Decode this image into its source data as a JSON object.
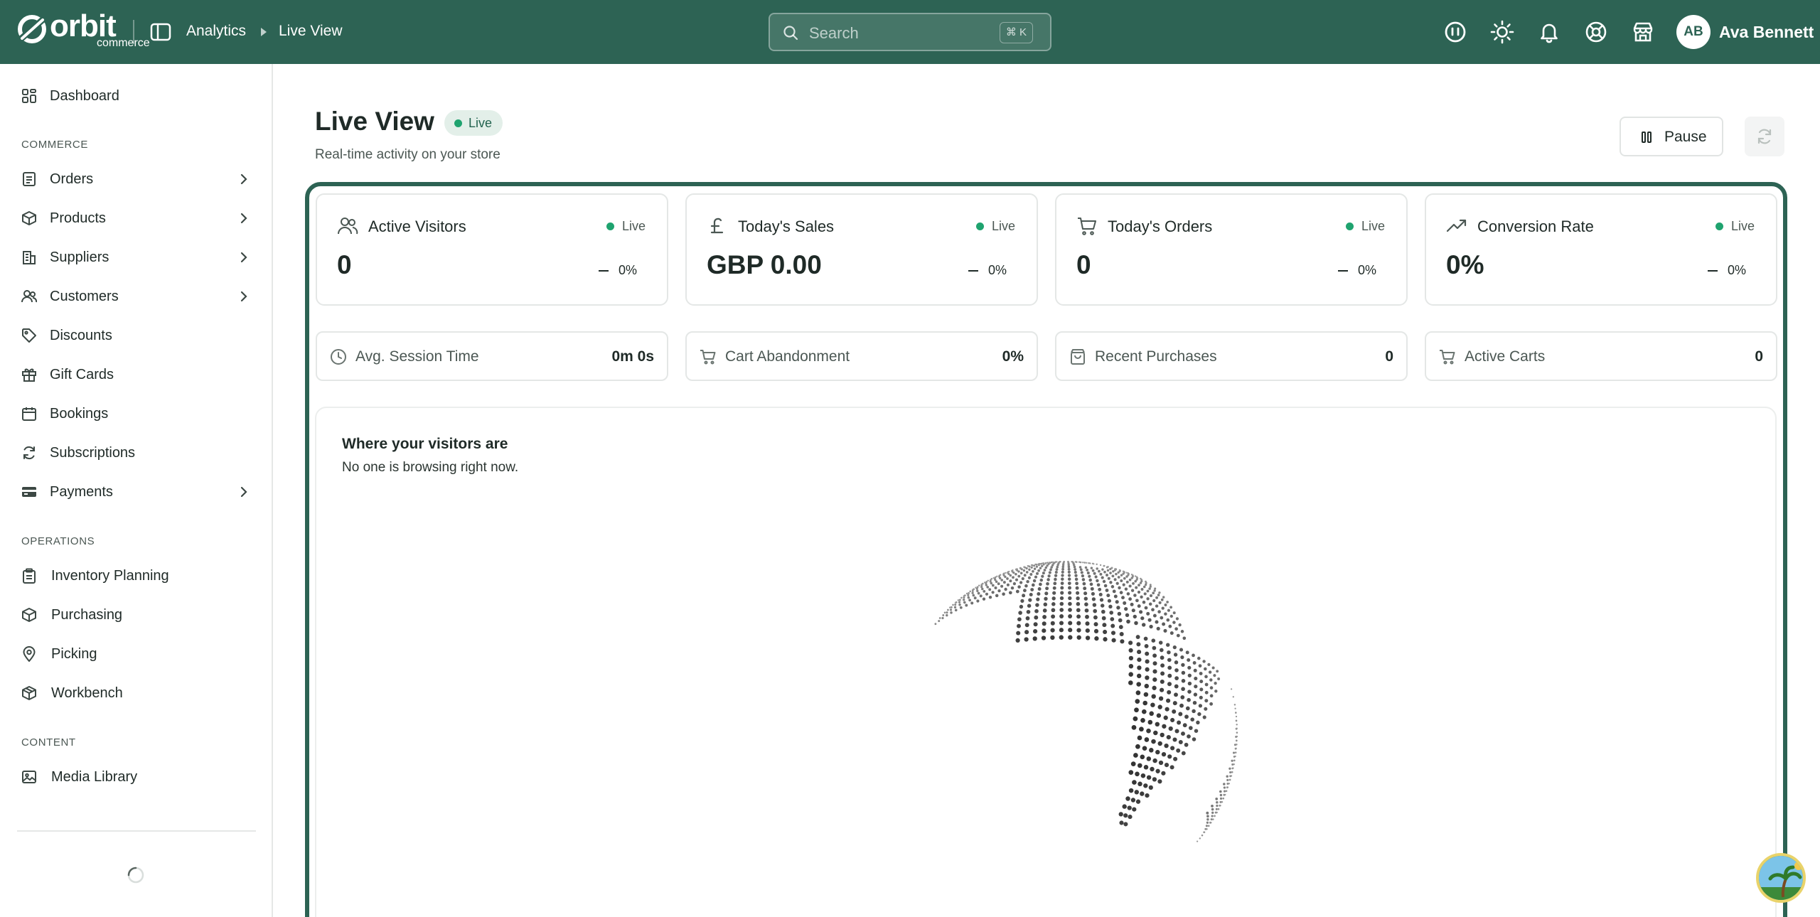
{
  "brand": {
    "name": "orbit",
    "sub": "commerce"
  },
  "topbar": {
    "breadcrumb": [
      "Analytics",
      "Live View"
    ],
    "search": {
      "placeholder": "Search",
      "shortcut": "⌘ K"
    },
    "icons": [
      "ai-assistant-icon",
      "theme-toggle-icon",
      "notifications-icon",
      "help-icon",
      "storefront-icon"
    ],
    "user": {
      "initials": "AB",
      "name": "Ava Bennett"
    }
  },
  "sidebar": {
    "top": [
      {
        "label": "Dashboard",
        "icon": "dashboard-icon"
      }
    ],
    "sections": [
      {
        "title": "COMMERCE",
        "items": [
          {
            "label": "Orders",
            "icon": "orders-icon",
            "chevron": true
          },
          {
            "label": "Products",
            "icon": "box-icon",
            "chevron": true
          },
          {
            "label": "Suppliers",
            "icon": "building-icon",
            "chevron": true
          },
          {
            "label": "Customers",
            "icon": "users-icon",
            "chevron": true
          },
          {
            "label": "Discounts",
            "icon": "tag-icon",
            "chevron": false
          },
          {
            "label": "Gift Cards",
            "icon": "gift-icon",
            "chevron": false
          },
          {
            "label": "Bookings",
            "icon": "calendar-icon",
            "chevron": false
          },
          {
            "label": "Subscriptions",
            "icon": "repeat-icon",
            "chevron": false
          },
          {
            "label": "Payments",
            "icon": "card-icon",
            "chevron": true
          }
        ]
      },
      {
        "title": "OPERATIONS",
        "items": [
          {
            "label": "Inventory Planning",
            "icon": "clipboard-icon"
          },
          {
            "label": "Purchasing",
            "icon": "box-icon"
          },
          {
            "label": "Picking",
            "icon": "map-pin-icon"
          },
          {
            "label": "Workbench",
            "icon": "package-icon"
          }
        ]
      },
      {
        "title": "CONTENT",
        "items": [
          {
            "label": "Media Library",
            "icon": "image-icon"
          }
        ]
      }
    ]
  },
  "page": {
    "title": "Live View",
    "badge": "Live",
    "subtitle": "Real-time activity on your store",
    "pause_label": "Pause"
  },
  "stats": [
    {
      "title": "Active Visitors",
      "live": "Live",
      "value": "0",
      "delta": "0%",
      "icon": "users-icon"
    },
    {
      "title": "Today's Sales",
      "live": "Live",
      "value": "GBP 0.00",
      "delta": "0%",
      "icon": "pound-icon"
    },
    {
      "title": "Today's Orders",
      "live": "Live",
      "value": "0",
      "delta": "0%",
      "icon": "cart-icon"
    },
    {
      "title": "Conversion Rate",
      "live": "Live",
      "value": "0%",
      "delta": "0%",
      "icon": "trend-up-icon"
    }
  ],
  "mini_stats": [
    {
      "title": "Avg. Session Time",
      "value": "0m 0s",
      "icon": "clock-icon"
    },
    {
      "title": "Cart Abandonment",
      "value": "0%",
      "icon": "cart-icon"
    },
    {
      "title": "Recent Purchases",
      "value": "0",
      "icon": "bag-icon"
    },
    {
      "title": "Active Carts",
      "value": "0",
      "icon": "cart-icon"
    }
  ],
  "map": {
    "title": "Where your visitors are",
    "subtitle": "No one is browsing right now."
  }
}
